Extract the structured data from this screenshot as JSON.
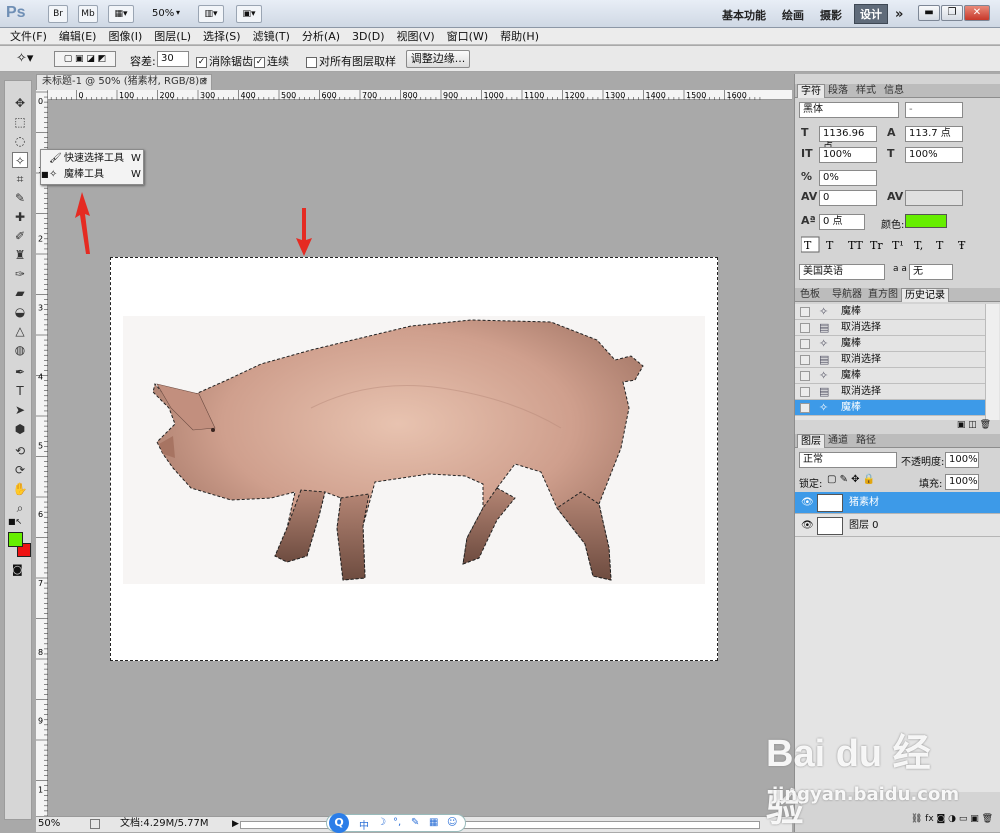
{
  "app": {
    "logo": "Ps",
    "zoom_menu": "50%"
  },
  "workspaces": [
    "基本功能",
    "绘画",
    "摄影",
    "设计"
  ],
  "menu": [
    "文件(F)",
    "编辑(E)",
    "图像(I)",
    "图层(L)",
    "选择(S)",
    "滤镜(T)",
    "分析(A)",
    "3D(D)",
    "视图(V)",
    "窗口(W)",
    "帮助(H)"
  ],
  "options": {
    "tolerance_label": "容差:",
    "tolerance_value": "30",
    "antialias_label": "消除锯齿",
    "contiguous_label": "连续",
    "sample_all_label": "对所有图层取样",
    "refine_button": "调整边缘..."
  },
  "document": {
    "tab_title": "未标题-1 @ 50% (猪素材, RGB/8) *",
    "ruler_h": [
      "100",
      "0",
      "100",
      "200",
      "300",
      "400",
      "500",
      "600",
      "700",
      "800",
      "900",
      "1000",
      "1100",
      "1200",
      "1300",
      "1400",
      "1500",
      "1600"
    ],
    "ruler_v": [
      "0",
      "1",
      "2",
      "3",
      "4",
      "5",
      "6",
      "7",
      "8",
      "9",
      "1"
    ]
  },
  "flyout": {
    "items": [
      {
        "label": "快速选择工具",
        "key": "W"
      },
      {
        "label": "魔棒工具",
        "key": "W"
      }
    ]
  },
  "status": {
    "zoom": "50%",
    "doc_info": "文档:4.29M/5.77M"
  },
  "character": {
    "tabs": [
      "字符",
      "段落",
      "样式",
      "信息"
    ],
    "font_family": "黑体",
    "font_style": "-",
    "font_size": "1136.96 点",
    "leading": "113.7 点",
    "v_scale": "100%",
    "h_scale": "100%",
    "tracking_pct": "0%",
    "kerning": "0",
    "baseline": "0 点",
    "color_label": "颜色:",
    "color": "#66ee00",
    "language": "美国英语",
    "aa_label": "a a",
    "aa_value": "无",
    "style_buttons": [
      "T",
      "T",
      "TT",
      "Tr",
      "T¹",
      "T,",
      "T",
      "Ŧ"
    ]
  },
  "history": {
    "tabs": [
      "色板",
      "导航器",
      "直方图",
      "历史记录"
    ],
    "items": [
      "魔棒",
      "取消选择",
      "魔棒",
      "取消选择",
      "魔棒",
      "取消选择",
      "魔棒"
    ],
    "selected_index": 6
  },
  "layers": {
    "tabs": [
      "图层",
      "通道",
      "路径"
    ],
    "blend_mode": "正常",
    "opacity_label": "不透明度:",
    "opacity": "100%",
    "lock_label": "锁定:",
    "fill_label": "填充:",
    "fill": "100%",
    "items": [
      {
        "name": "猪素材",
        "selected": true
      },
      {
        "name": "图层 0",
        "selected": false
      }
    ],
    "footer_icons": [
      "link-icon",
      "fx",
      "mask-icon",
      "adjust-icon",
      "folder-icon",
      "new-icon",
      "trash-icon"
    ]
  },
  "colors": {
    "foreground": "#66ee00",
    "background": "#ee1111",
    "accent": "#3d8ee0",
    "selection": "#3d9ae8"
  },
  "taskbar": {
    "items": [
      "中",
      "☽",
      "°,",
      "✎",
      "▦",
      "☺"
    ]
  },
  "watermark": {
    "brand": "Bai du 经验",
    "url": "jingyan.baidu.com"
  }
}
